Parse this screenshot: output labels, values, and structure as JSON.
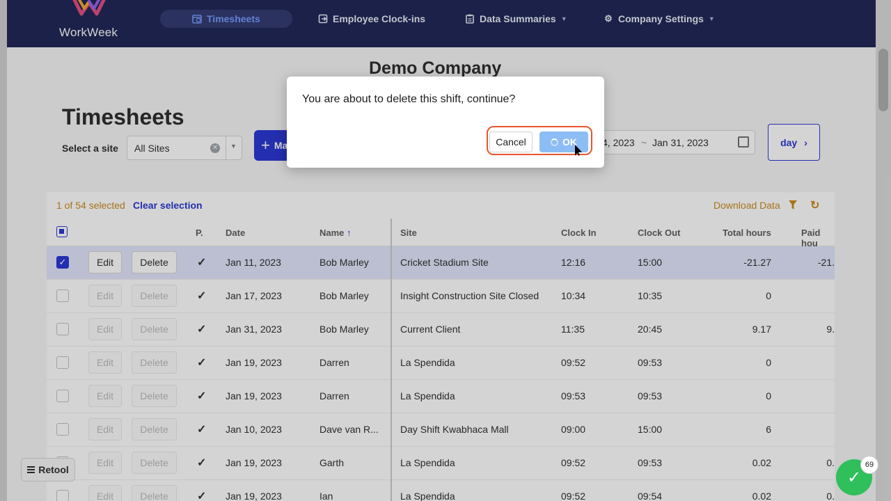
{
  "app": {
    "brand": "WorkWeek",
    "colors": {
      "nav_bg": "#131a4d",
      "accent": "#1e2bd1",
      "warning": "#c78310",
      "selected_row": "#dfe4fb",
      "highlight": "#e8562d",
      "success": "#2fbf5b"
    }
  },
  "nav": {
    "items": [
      {
        "label": "Timesheets",
        "icon": "timesheet-icon",
        "active": true
      },
      {
        "label": "Employee Clock-ins",
        "icon": "clock-in-icon"
      },
      {
        "label": "Data Summaries",
        "icon": "clipboard-icon",
        "has_dropdown": true
      },
      {
        "label": "Company Settings",
        "icon": "gear-icon",
        "has_dropdown": true
      }
    ]
  },
  "header": {
    "company": "Demo Company",
    "page_title": "Timesheets"
  },
  "filters": {
    "site_label": "Select a site",
    "site_value": "All Sites",
    "make_button_label": "Ma",
    "date_start": "4, 2023",
    "date_end": "Jan 31, 2023",
    "day_button": "day"
  },
  "table": {
    "selection_count": "1 of 54 selected",
    "clear_selection": "Clear selection",
    "download": "Download Data",
    "columns": {
      "p": "P.",
      "date": "Date",
      "name": "Name",
      "site": "Site",
      "clock_in": "Clock In",
      "clock_out": "Clock Out",
      "total_hours": "Total hours",
      "paid_hours": "Paid hou"
    },
    "edit_label": "Edit",
    "delete_label": "Delete",
    "rows": [
      {
        "selected": true,
        "p": "✓",
        "date": "Jan 11, 2023",
        "name": "Bob Marley",
        "site": "Cricket Stadium Site",
        "clock_in": "12:16",
        "clock_out": "15:00",
        "total": "-21.27",
        "paid": "-21."
      },
      {
        "selected": false,
        "p": "✓",
        "date": "Jan 17, 2023",
        "name": "Bob Marley",
        "site": "Insight Construction Site Closed",
        "clock_in": "10:34",
        "clock_out": "10:35",
        "total": "0",
        "paid": ""
      },
      {
        "selected": false,
        "p": "✓",
        "date": "Jan 31, 2023",
        "name": "Bob Marley",
        "site": "Current Client",
        "clock_in": "11:35",
        "clock_out": "20:45",
        "total": "9.17",
        "paid": "9."
      },
      {
        "selected": false,
        "p": "✓",
        "date": "Jan 19, 2023",
        "name": "Darren",
        "site": "La Spendida",
        "clock_in": "09:52",
        "clock_out": "09:53",
        "total": "0",
        "paid": ""
      },
      {
        "selected": false,
        "p": "✓",
        "date": "Jan 19, 2023",
        "name": "Darren",
        "site": "La Spendida",
        "clock_in": "09:53",
        "clock_out": "09:53",
        "total": "0",
        "paid": ""
      },
      {
        "selected": false,
        "p": "✓",
        "date": "Jan 10, 2023",
        "name": "Dave van R...",
        "site": "Day Shift Kwabhaca Mall",
        "clock_in": "09:00",
        "clock_out": "15:00",
        "total": "6",
        "paid": ""
      },
      {
        "selected": false,
        "p": "✓",
        "date": "Jan 19, 2023",
        "name": "Garth",
        "site": "La Spendida",
        "clock_in": "09:52",
        "clock_out": "09:53",
        "total": "0.02",
        "paid": "0."
      },
      {
        "selected": false,
        "p": "✓",
        "date": "Jan 19, 2023",
        "name": "Ian",
        "site": "La Spendida",
        "clock_in": "09:52",
        "clock_out": "09:54",
        "total": "0.02",
        "paid": "0."
      }
    ]
  },
  "modal": {
    "message": "You are about to delete this shift, continue?",
    "cancel": "Cancel",
    "ok": "OK"
  },
  "footer": {
    "retool_label": "Retool",
    "fab_badge": "69"
  }
}
